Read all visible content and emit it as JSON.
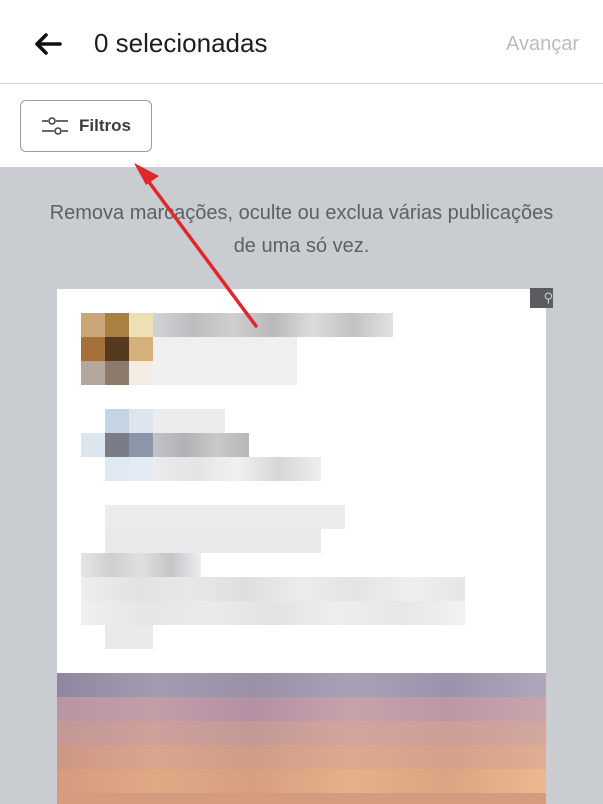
{
  "header": {
    "back_icon": "arrow-left-icon",
    "title": "0 selecionadas",
    "next_label": "Avançar"
  },
  "filter": {
    "icon": "sliders-icon",
    "label": "Filtros"
  },
  "info": {
    "text": "Remova marcações, oculte ou exclua várias publicações de uma só vez."
  },
  "colors": {
    "annotation_arrow": "#e0272a",
    "background_gray": "#c9ccd1",
    "next_disabled": "#b8bcc2"
  }
}
